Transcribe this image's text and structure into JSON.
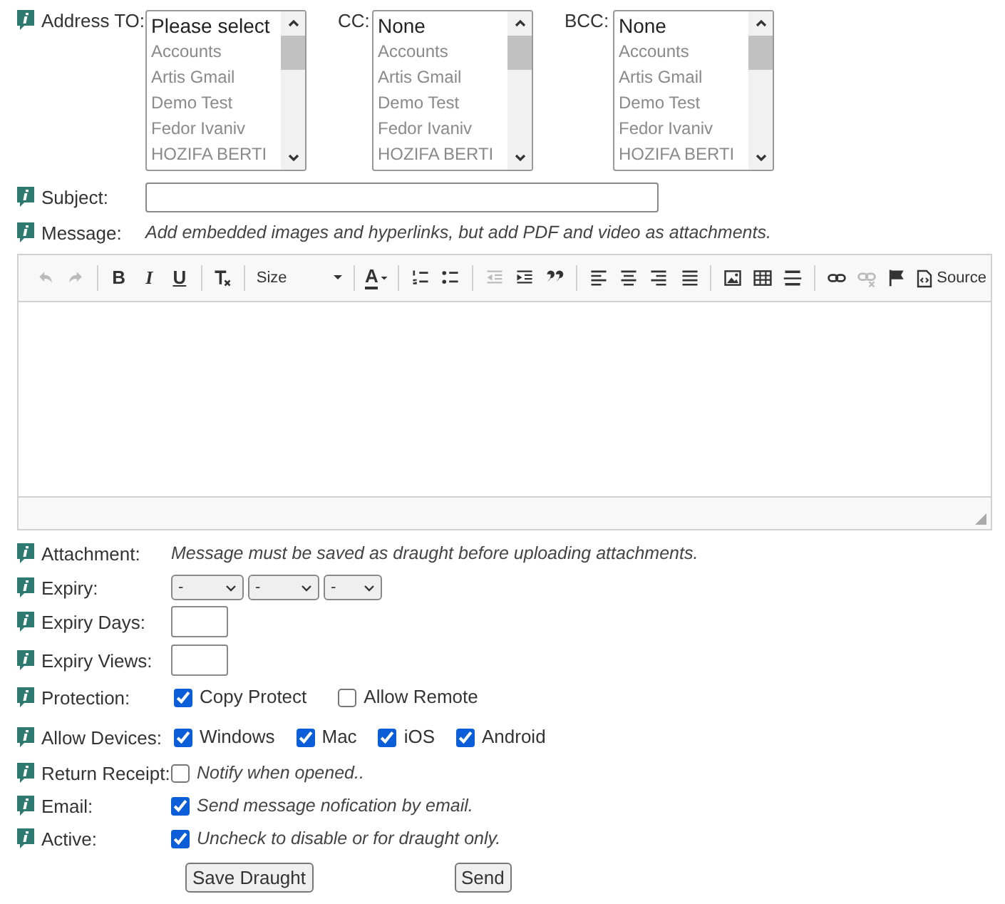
{
  "address": {
    "to": {
      "label": "Address TO:",
      "options": [
        "Please select",
        "Accounts",
        "Artis Gmail",
        "Demo Test",
        "Fedor Ivaniv",
        "HOZIFA BERTI"
      ]
    },
    "cc": {
      "label": "CC:",
      "options": [
        "None",
        "Accounts",
        "Artis Gmail",
        "Demo Test",
        "Fedor Ivaniv",
        "HOZIFA BERTI"
      ]
    },
    "bcc": {
      "label": "BCC:",
      "options": [
        "None",
        "Accounts",
        "Artis Gmail",
        "Demo Test",
        "Fedor Ivaniv",
        "HOZIFA BERTI"
      ]
    }
  },
  "subject": {
    "label": "Subject:"
  },
  "message": {
    "label": "Message:",
    "hint": "Add embedded images and hyperlinks, but add PDF and video as attachments."
  },
  "toolbar": [
    {
      "kind": "icon",
      "disabled": true
    },
    {
      "kind": "icon",
      "disabled": true
    },
    {
      "kind": "sep"
    },
    {
      "kind": "text",
      "label": "B",
      "disabled": false
    },
    {
      "kind": "text",
      "label": "I",
      "disabled": false
    },
    {
      "kind": "text",
      "label": "U",
      "disabled": false
    },
    {
      "kind": "sep"
    },
    {
      "kind": "icon",
      "disabled": false
    },
    {
      "kind": "sep"
    },
    {
      "kind": "dropdown",
      "label": "Size"
    },
    {
      "kind": "sep"
    },
    {
      "kind": "color",
      "label": "A"
    },
    {
      "kind": "sep"
    },
    {
      "kind": "icon",
      "disabled": false
    },
    {
      "kind": "icon",
      "disabled": false
    },
    {
      "kind": "sep"
    },
    {
      "kind": "icon",
      "disabled": true
    },
    {
      "kind": "icon",
      "disabled": false
    },
    {
      "kind": "icon",
      "disabled": false
    },
    {
      "kind": "sep"
    },
    {
      "kind": "icon",
      "disabled": false
    },
    {
      "kind": "icon",
      "disabled": false
    },
    {
      "kind": "icon",
      "disabled": false
    },
    {
      "kind": "icon",
      "disabled": false
    },
    {
      "kind": "sep"
    },
    {
      "kind": "icon",
      "disabled": false
    },
    {
      "kind": "icon",
      "disabled": false
    },
    {
      "kind": "icon",
      "disabled": false
    },
    {
      "kind": "sep"
    },
    {
      "kind": "icon",
      "disabled": false
    },
    {
      "kind": "icon",
      "disabled": true
    },
    {
      "kind": "icon",
      "disabled": false
    },
    {
      "kind": "source",
      "label": "Source"
    }
  ],
  "attachment": {
    "label": "Attachment:",
    "note": "Message must be saved as draught before uploading attachments."
  },
  "expiry": {
    "label": "Expiry:",
    "selects": [
      "-",
      "-",
      "-"
    ]
  },
  "expiry_days": {
    "label": "Expiry Days:"
  },
  "expiry_views": {
    "label": "Expiry Views:"
  },
  "protection": {
    "label": "Protection:",
    "options": [
      {
        "label": "Copy Protect",
        "checked": true
      },
      {
        "label": "Allow Remote",
        "checked": false
      }
    ]
  },
  "devices": {
    "label": "Allow Devices:",
    "options": [
      {
        "label": "Windows",
        "checked": true
      },
      {
        "label": "Mac",
        "checked": true
      },
      {
        "label": "iOS",
        "checked": true
      },
      {
        "label": "Android",
        "checked": true
      }
    ]
  },
  "return_receipt": {
    "label": "Return Receipt:",
    "checked": false,
    "note": "Notify when opened.."
  },
  "email": {
    "label": "Email:",
    "checked": true,
    "note": "Send message nofication by email."
  },
  "active": {
    "label": "Active:",
    "checked": true,
    "note": "Uncheck to disable or for draught only."
  },
  "buttons": [
    "Save Draught",
    "Send"
  ]
}
